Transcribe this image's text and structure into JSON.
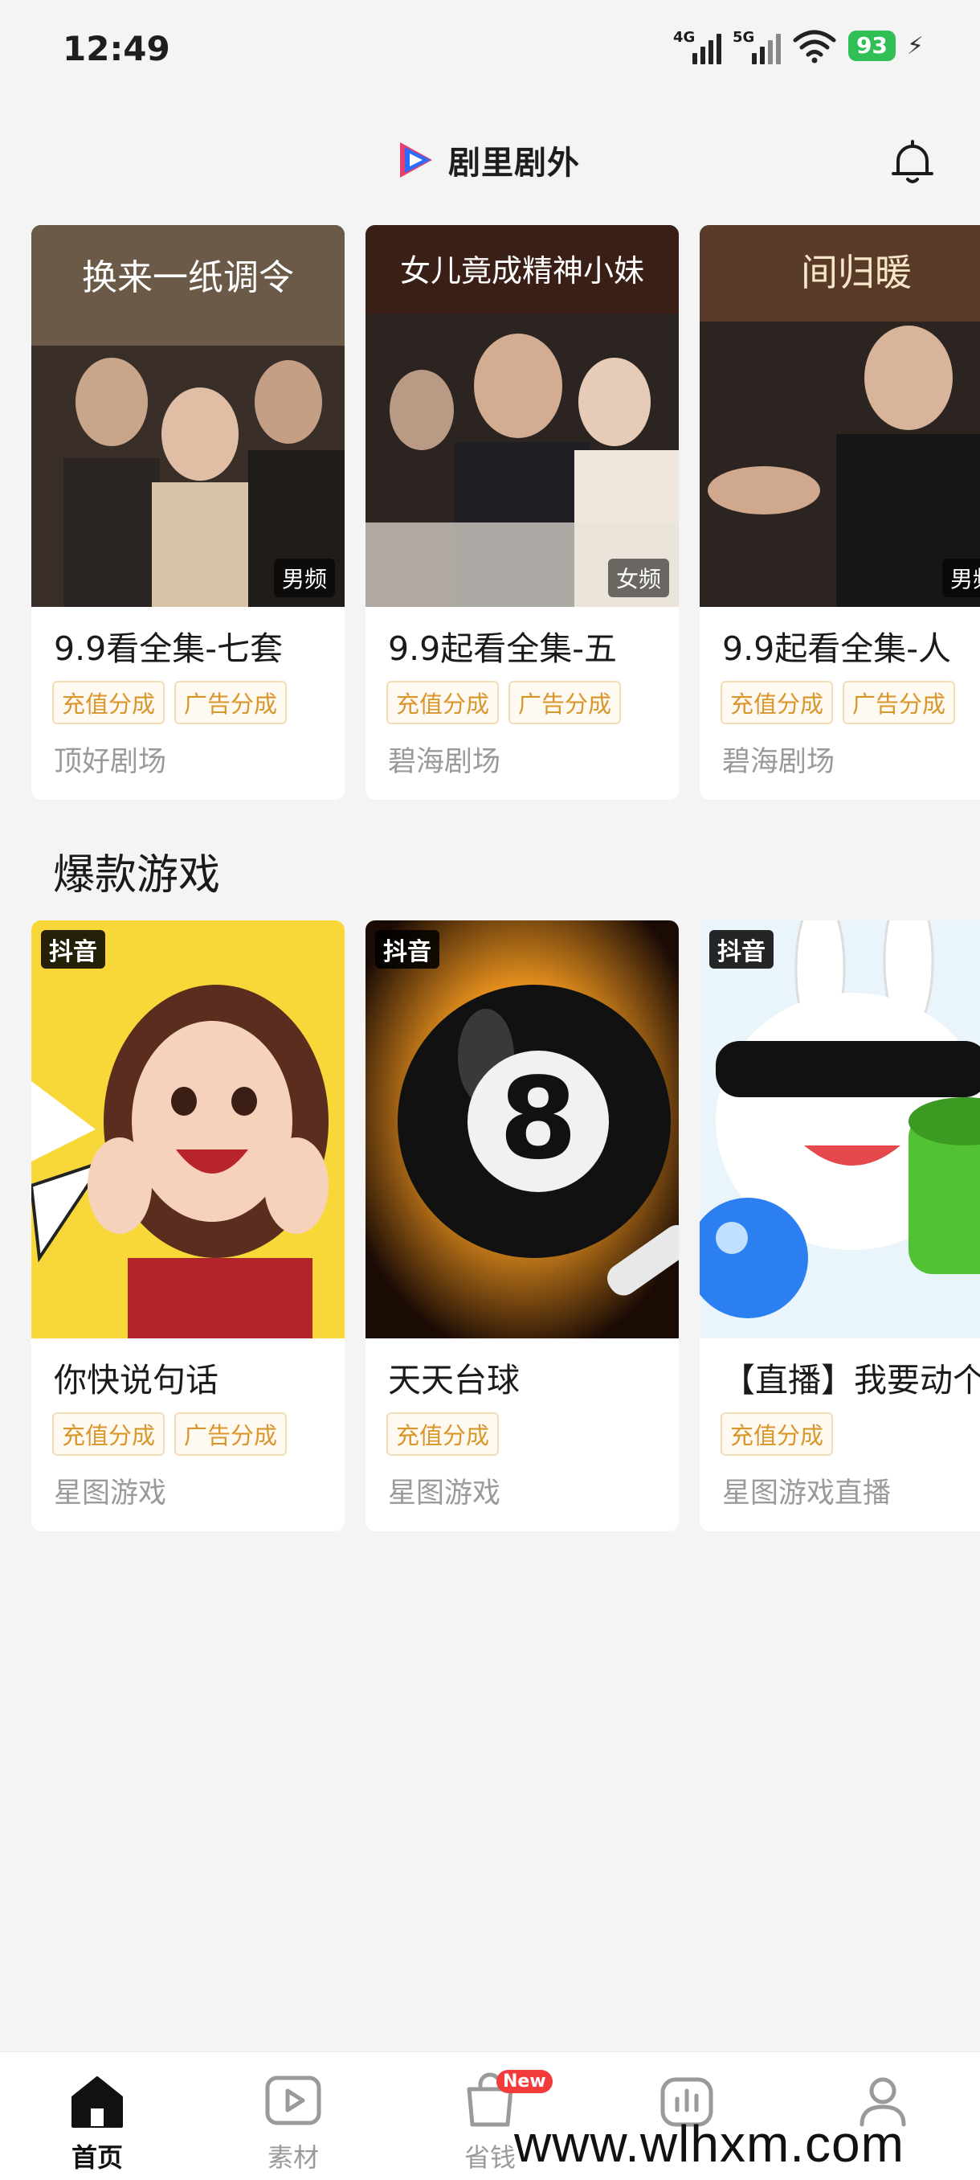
{
  "status_bar": {
    "time": "12:49",
    "network1": "4G",
    "network2": "5G",
    "battery": "93"
  },
  "header": {
    "app_name": "剧里剧外",
    "brand_colors": [
      "#e8406b",
      "#2b6cff",
      "#1d1d1f"
    ]
  },
  "drama_row": {
    "cards": [
      {
        "title": "9.9看全集-七套",
        "genre": "男频",
        "tags": [
          "充值分成",
          "广告分成"
        ],
        "source": "顶好剧场",
        "poster_text": "换来一纸调令"
      },
      {
        "title": "9.9起看全集-五",
        "genre": "女频",
        "tags": [
          "充值分成",
          "广告分成"
        ],
        "source": "碧海剧场",
        "poster_text": "女儿竟成精神小妹"
      },
      {
        "title": "9.9起看全集-人",
        "genre": "男频",
        "tags": [
          "充值分成",
          "广告分成"
        ],
        "source": "碧海剧场",
        "poster_text": "间归暖"
      }
    ]
  },
  "games_section": {
    "title": "爆款游戏",
    "cards": [
      {
        "title": "你快说句话",
        "platform": "抖音",
        "tags": [
          "充值分成",
          "广告分成"
        ],
        "source": "星图游戏"
      },
      {
        "title": "天天台球",
        "platform": "抖音",
        "tags": [
          "充值分成"
        ],
        "source": "星图游戏"
      },
      {
        "title": "【直播】我要动个",
        "platform": "抖音",
        "tags": [
          "充值分成"
        ],
        "source": "星图游戏直播"
      }
    ]
  },
  "bottom_nav": {
    "items": [
      {
        "label": "首页",
        "icon": "home-icon",
        "active": true
      },
      {
        "label": "素材",
        "icon": "play-icon",
        "active": false
      },
      {
        "label": "省钱",
        "icon": "bag-icon",
        "active": false,
        "badge": "New"
      },
      {
        "label": "",
        "icon": "chart-icon",
        "active": false
      },
      {
        "label": "",
        "icon": "user-icon",
        "active": false
      }
    ]
  },
  "watermark": "www.wlhxm.com"
}
